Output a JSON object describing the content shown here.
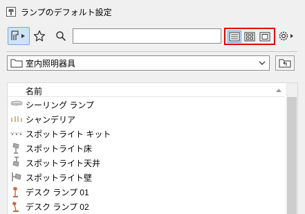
{
  "window": {
    "title": "ランプのデフォルト設定"
  },
  "toolbar": {
    "search_value": "",
    "view_buttons": [
      "list-view",
      "grid-view",
      "preview-view"
    ],
    "active_view": "list-view"
  },
  "folder": {
    "selected": "室内照明器具"
  },
  "list": {
    "column_header": "名前",
    "items": [
      {
        "label": "シーリング ランプ",
        "icon": "ceiling-lamp-icon"
      },
      {
        "label": "シャンデリア",
        "icon": "chandelier-icon"
      },
      {
        "label": "スポットライト キット",
        "icon": "spotlight-kit-icon"
      },
      {
        "label": "スポットライト床",
        "icon": "floor-spotlight-icon"
      },
      {
        "label": "スポットライト天井",
        "icon": "ceiling-spotlight-icon"
      },
      {
        "label": "スポットライト壁",
        "icon": "wall-spotlight-icon"
      },
      {
        "label": "デスク ランプ 01",
        "icon": "desk-lamp-icon"
      },
      {
        "label": "デスク ランプ 02",
        "icon": "desk-lamp-icon"
      }
    ]
  },
  "colors": {
    "highlight": "#e10000",
    "selection": "#cfe3f6"
  }
}
